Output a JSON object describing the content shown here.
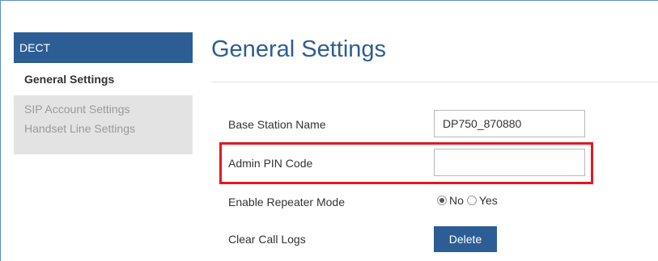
{
  "sidebar": {
    "header": "DECT",
    "items": [
      {
        "label": "General Settings",
        "active": true
      },
      {
        "label": "SIP Account Settings",
        "active": false
      },
      {
        "label": "Handset Line Settings",
        "active": false
      }
    ]
  },
  "main": {
    "title": "General Settings",
    "fields": {
      "base_station_name": {
        "label": "Base Station Name",
        "value": "DP750_870880"
      },
      "admin_pin_code": {
        "label": "Admin PIN Code",
        "value": ""
      },
      "enable_repeater_mode": {
        "label": "Enable Repeater Mode",
        "options": [
          "No",
          "Yes"
        ],
        "selected": "No"
      },
      "clear_call_logs": {
        "label": "Clear Call Logs",
        "button_label": "Delete"
      }
    }
  },
  "colors": {
    "accent": "#2d5d95",
    "highlight": "#e01a22",
    "sidebar_inactive_bg": "#e3e3e3"
  }
}
